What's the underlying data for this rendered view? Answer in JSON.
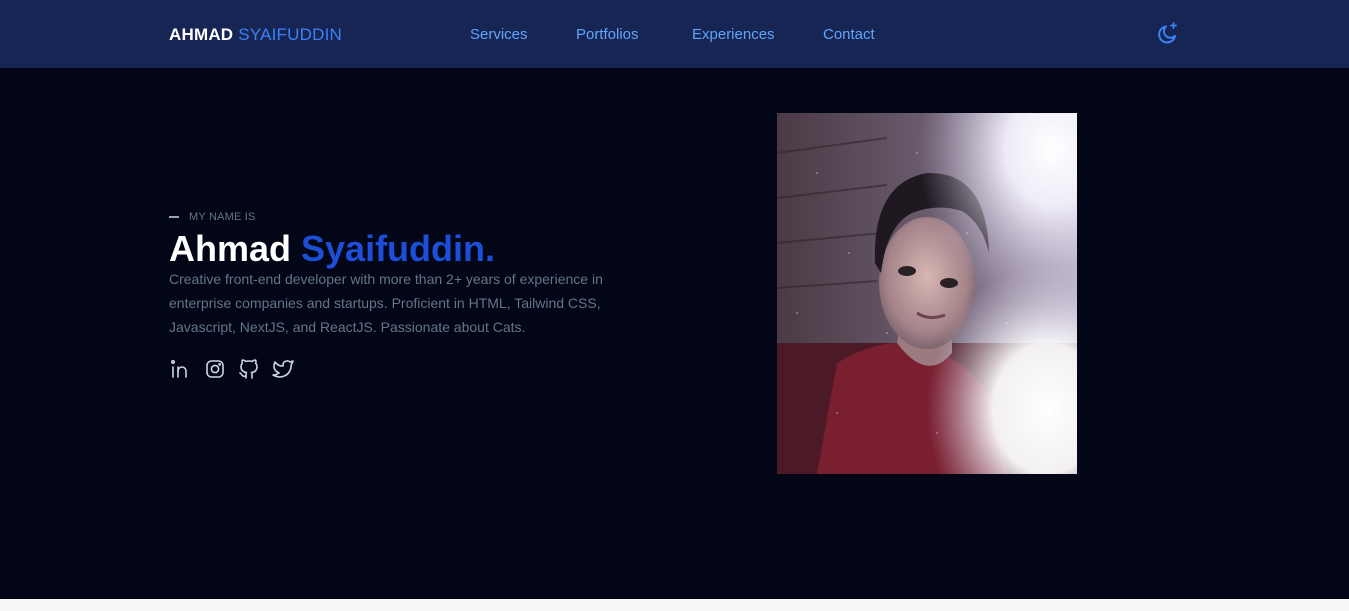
{
  "brand": {
    "first": "AHMAD",
    "last": "SYAIFUDDIN"
  },
  "nav": {
    "items": [
      {
        "label": "Services"
      },
      {
        "label": "Portfolios"
      },
      {
        "label": "Experiences"
      },
      {
        "label": "Contact"
      }
    ],
    "theme_toggle_icon": "moon-star-icon"
  },
  "hero": {
    "eyebrow": "MY NAME IS",
    "name_first": "Ahmad",
    "name_last": "Syaifuddin.",
    "description": "Creative front-end developer with more than 2+ years of experience in enterprise companies and startups. Proficient in HTML, Tailwind CSS, Javascript, NextJS, and ReactJS. Passionate about Cats.",
    "socials": [
      {
        "icon": "linkedin-icon"
      },
      {
        "icon": "instagram-icon"
      },
      {
        "icon": "github-icon"
      },
      {
        "icon": "twitter-icon"
      }
    ]
  },
  "colors": {
    "navbar_bg": "#172554",
    "page_bg": "#020617",
    "accent": "#1d4ed8",
    "nav_link": "#60a5fa",
    "muted_text": "#64748b"
  }
}
